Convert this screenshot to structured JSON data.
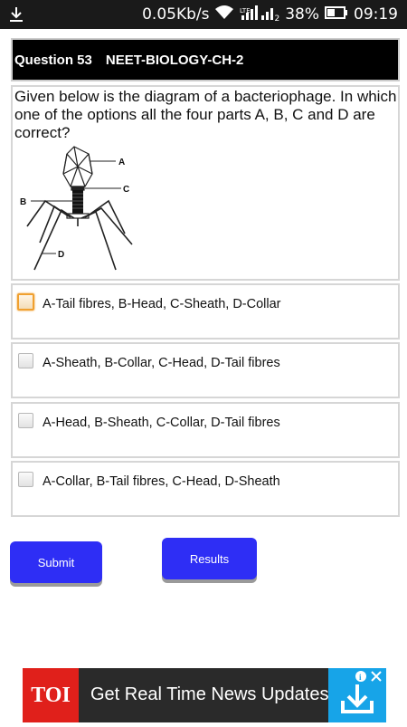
{
  "status_bar": {
    "speed": "0.05Kb/s",
    "battery": "38%",
    "time": "09:19",
    "sim_marker": "2",
    "icons": [
      "download-icon",
      "wifi-icon",
      "signal-icon",
      "battery-icon"
    ]
  },
  "question": {
    "number_label": "Question 53",
    "category": "NEET-BIOLOGY-CH-2",
    "text": "Given below is the diagram of a bacteriophage. In which one of the options all the four parts A, B, C and D are correct?",
    "figure_labels": [
      "A",
      "B",
      "C",
      "D"
    ]
  },
  "options": [
    {
      "label": "A-Tail fibres, B-Head, C-Sheath, D-Collar",
      "checked": false,
      "focused": true
    },
    {
      "label": "A-Sheath, B-Collar, C-Head, D-Tail fibres",
      "checked": false,
      "focused": false
    },
    {
      "label": "A-Head, B-Sheath, C-Collar, D-Tail fibres",
      "checked": false,
      "focused": false
    },
    {
      "label": "A-Collar, B-Tail fibres, C-Head, D-Sheath",
      "checked": false,
      "focused": false
    }
  ],
  "buttons": {
    "submit": "Submit",
    "results": "Results"
  },
  "ad": {
    "logo": "TOI",
    "text": "Get Real Time News Updates",
    "icons": [
      "info-icon",
      "close-icon",
      "download-icon"
    ]
  },
  "colors": {
    "button_blue": "#2e2ef5",
    "header_black": "#000000",
    "ad_red": "#e0201b",
    "ad_blue": "#17a4e8",
    "focus_orange": "#f0a030"
  }
}
